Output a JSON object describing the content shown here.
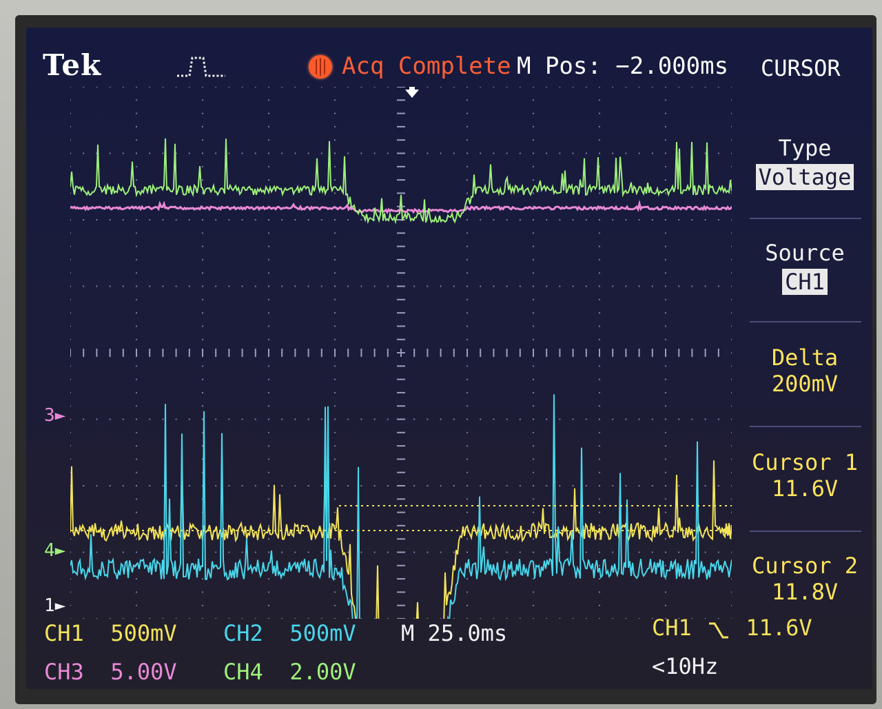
{
  "header": {
    "brand": "Tek",
    "acq_status": "Acq Complete",
    "m_pos": "M Pos: −2.000ms",
    "menu_title": "CURSOR"
  },
  "menu": {
    "type_label": "Type",
    "type_value": "Voltage",
    "source_label": "Source",
    "source_value": "CH1",
    "delta_label": "Delta",
    "delta_value": "200mV",
    "cursor1_label": "Cursor 1",
    "cursor1_value": "11.6V",
    "cursor2_label": "Cursor 2",
    "cursor2_value": "11.8V"
  },
  "markers": {
    "ch3": "3",
    "ch4": "4",
    "ch1": "1"
  },
  "channels": {
    "ch1": {
      "label": "CH1",
      "scale": "500mV"
    },
    "ch2": {
      "label": "CH2",
      "scale": "500mV"
    },
    "ch3": {
      "label": "CH3",
      "scale": "5.00V"
    },
    "ch4": {
      "label": "CH4",
      "scale": "2.00V"
    }
  },
  "timebase": "M 25.0ms",
  "trigger": {
    "source": "CH1",
    "slope_icon": "falling-edge-icon",
    "level": "11.6V",
    "freq": "<10Hz"
  },
  "colors": {
    "ch1": "#f2e35a",
    "ch2": "#49d6ea",
    "ch3": "#e889d6",
    "ch4": "#9ef07a",
    "acq": "#ff5f35"
  },
  "icons": [
    "trigger-pulse-icon",
    "acq-status-icon",
    "trigger-position-icon",
    "falling-edge-icon",
    "cursor-arrow-icon"
  ]
}
